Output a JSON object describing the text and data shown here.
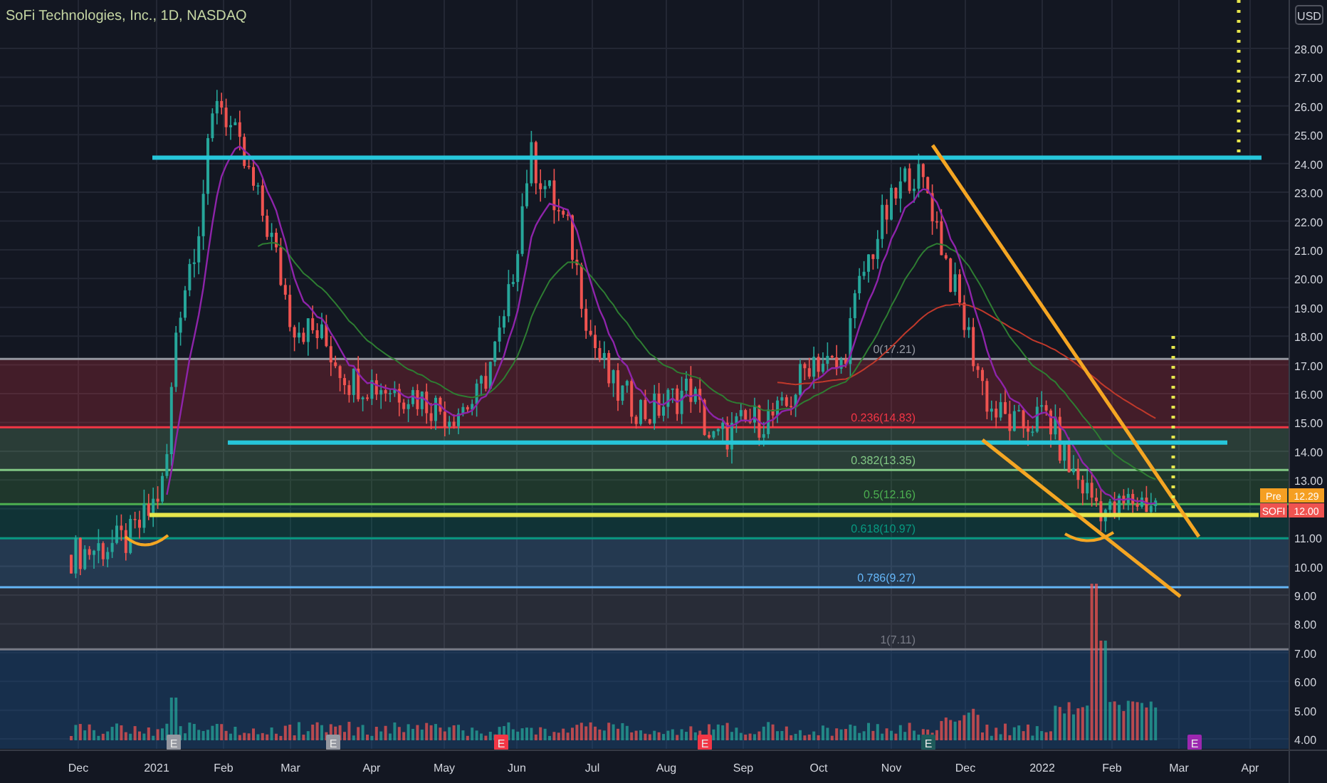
{
  "chart": {
    "title": "SoFi Technologies, Inc., 1D, NASDAQ",
    "currency": "USD",
    "price_axis_upper": [
      "28.00",
      "27.00",
      "26.00",
      "25.00",
      "24.00",
      "23.00",
      "22.00",
      "21.00",
      "20.00",
      "19.00",
      "18.00",
      "17.00",
      "16.00",
      "15.00",
      "14.00",
      "13.00"
    ],
    "price_axis_lower": [
      "11.00",
      "10.00",
      "9.00",
      "8.00",
      "7.00",
      "6.00",
      "5.00",
      "4.00"
    ],
    "time_axis": [
      "Dec",
      "2021",
      "Feb",
      "Mar",
      "Apr",
      "May",
      "Jun",
      "Jul",
      "Aug",
      "Sep",
      "Oct",
      "Nov",
      "Dec",
      "2022",
      "Feb",
      "Mar",
      "Apr"
    ],
    "fib_levels": [
      {
        "label": "0(17.21)",
        "color": "#9598a1"
      },
      {
        "label": "0.236(14.83)",
        "color": "#f23645"
      },
      {
        "label": "0.382(13.35)",
        "color": "#81c784"
      },
      {
        "label": "0.5(12.16)",
        "color": "#4caf50"
      },
      {
        "label": "0.618(10.97)",
        "color": "#089981"
      },
      {
        "label": "0.786(9.27)",
        "color": "#64b5f6"
      },
      {
        "label": "1(7.11)",
        "color": "#787b86"
      }
    ],
    "earnings_markers": [
      {
        "label": "E",
        "color": "#9598a1"
      },
      {
        "label": "E",
        "color": "#9598a1"
      },
      {
        "label": "E",
        "color": "#f23645"
      },
      {
        "label": "E",
        "color": "#f23645"
      },
      {
        "label": "E",
        "color": "#1e5a5a"
      },
      {
        "label": "E",
        "color": "#9c27b0"
      }
    ],
    "price_tags": [
      {
        "label": "Pre",
        "value": "12.29",
        "color": "#f59f22"
      },
      {
        "label": "SOFI",
        "value": "12.00",
        "color": "#ef5350"
      }
    ]
  }
}
